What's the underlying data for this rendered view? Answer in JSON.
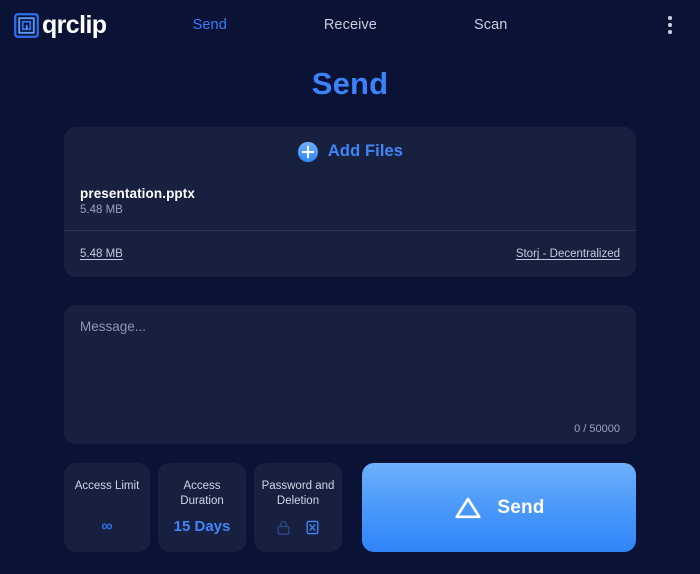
{
  "app": {
    "logo_text": "qrclip",
    "logo_icon": "qr-spiral-icon",
    "brand_color": "#3b82fb",
    "background_color": "#0a1236",
    "card_color": "#18203f"
  },
  "nav": {
    "items": [
      {
        "label": "Send",
        "active": true
      },
      {
        "label": "Receive",
        "active": false
      },
      {
        "label": "Scan",
        "active": false
      }
    ],
    "menu_icon": "kebab-menu-icon"
  },
  "page": {
    "title": "Send"
  },
  "file_card": {
    "add_files_label": "Add Files",
    "add_files_icon": "plus-circle-icon",
    "files": [
      {
        "name": "presentation.pptx",
        "size": "5.48 MB"
      }
    ],
    "footer": {
      "total_size": "5.48 MB",
      "storage_provider": "Storj - Decentralized"
    }
  },
  "message": {
    "placeholder": "Message...",
    "value": "",
    "counter": "0 / 50000"
  },
  "options": [
    {
      "title": "Access Limit",
      "value": "∞",
      "value_type": "glyph",
      "name": "access-limit"
    },
    {
      "title": "Access Duration",
      "value": "15 Days",
      "value_type": "text",
      "name": "access-duration"
    },
    {
      "title": "Password and Deletion",
      "value": "",
      "value_type": "icons",
      "name": "password-and-deletion",
      "icons": [
        {
          "name": "lock-icon",
          "state": "inactive"
        },
        {
          "name": "delete-box-icon",
          "state": "active"
        }
      ]
    }
  ],
  "send_button": {
    "label": "Send",
    "icon": "triangle-up-icon"
  }
}
